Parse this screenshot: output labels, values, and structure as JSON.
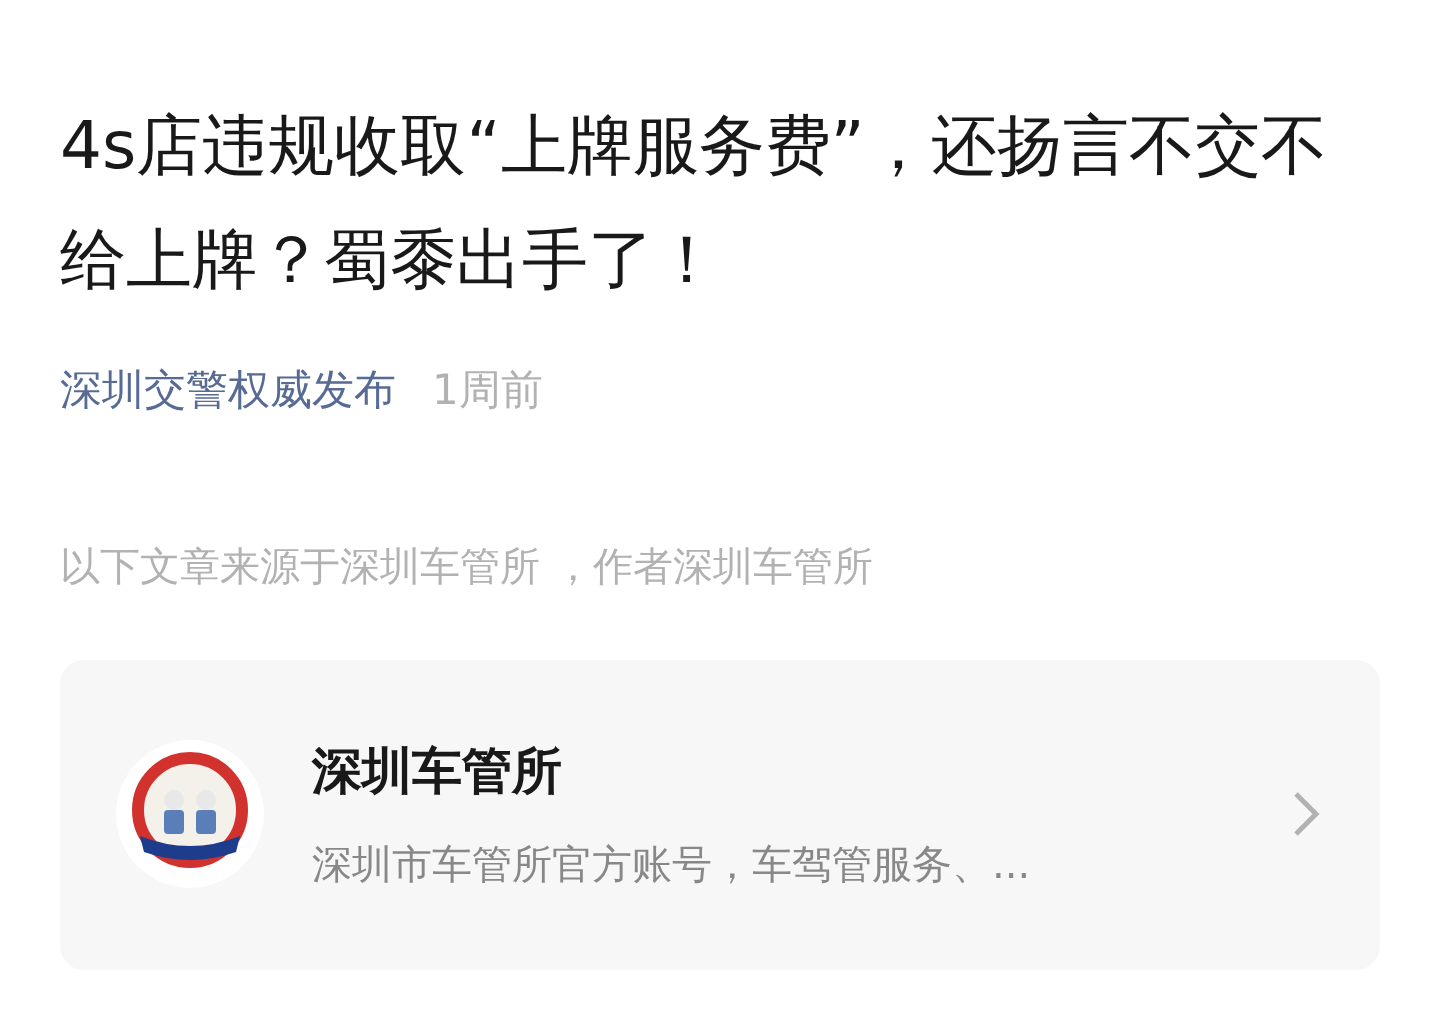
{
  "article": {
    "title": "4s店违规收取“上牌服务费”，还扬言不交不给上牌？蜀黍出手了！",
    "author": "深圳交警权威发布",
    "time": "1周前",
    "source_note": "以下文章来源于深圳车管所 ，作者深圳车管所"
  },
  "account_card": {
    "name": "深圳车管所",
    "description": "深圳市车管所官方账号，车驾管服务、..."
  }
}
